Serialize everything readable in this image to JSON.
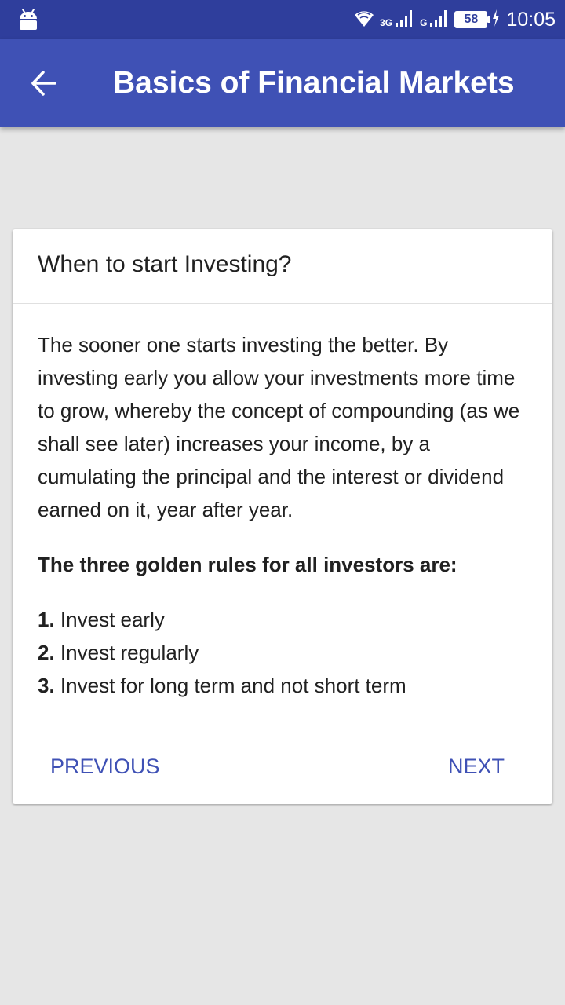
{
  "status_bar": {
    "network_type_1": "3G",
    "network_type_2": "G",
    "battery_level": "58",
    "time": "10:05"
  },
  "app_bar": {
    "title": "Basics of Financial Markets"
  },
  "card": {
    "title": "When to start Investing?",
    "paragraph": "The sooner one starts investing the better. By investing early you allow your investments more time to grow, whereby the concept of compounding (as we shall see later) increases your income, by a cumulating the principal and the interest or dividend earned on it, year after year.",
    "rules_heading": "The three golden rules for all investors are:",
    "rules": [
      {
        "number": "1.",
        "text": "Invest early"
      },
      {
        "number": "2.",
        "text": "Invest regularly"
      },
      {
        "number": "3.",
        "text": "Invest for long term and not short term"
      }
    ],
    "previous_label": "PREVIOUS",
    "next_label": "NEXT"
  },
  "colors": {
    "status_bar": "#2f3e9c",
    "app_bar": "#3f51b5",
    "background": "#e6e6e6",
    "accent": "#3f51b5"
  }
}
